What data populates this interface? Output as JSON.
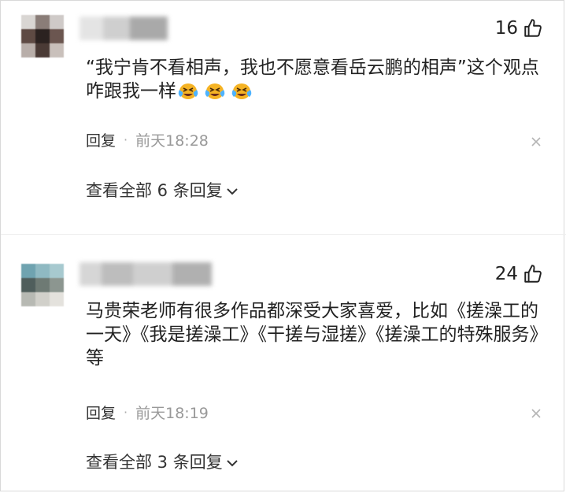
{
  "comments": [
    {
      "likes": "16",
      "text": "“我宁肯不看相声，我也不愿意看岳云鹏的相声”这个观点咋跟我一样",
      "emoji_count": 3,
      "reply_label": "回复",
      "time": "前天18:28",
      "view_all": "查看全部 6 条回复"
    },
    {
      "likes": "24",
      "text": "马贵荣老师有很多作品都深受大家喜爱，比如《搓澡工的一天》《我是搓澡工》《干搓与湿搓》《搓澡工的特殊服务》等",
      "reply_label": "回复",
      "time": "前天18:19",
      "view_all": "查看全部 3 条回复"
    }
  ],
  "icons": {
    "like": "thumbs-up-icon",
    "close": "close-icon",
    "chevron": "chevron-down-icon",
    "emoji": "laughing-crying-emoji"
  },
  "colors": {
    "text": "#222222",
    "meta": "#999999",
    "emoji": "#f5b324"
  }
}
